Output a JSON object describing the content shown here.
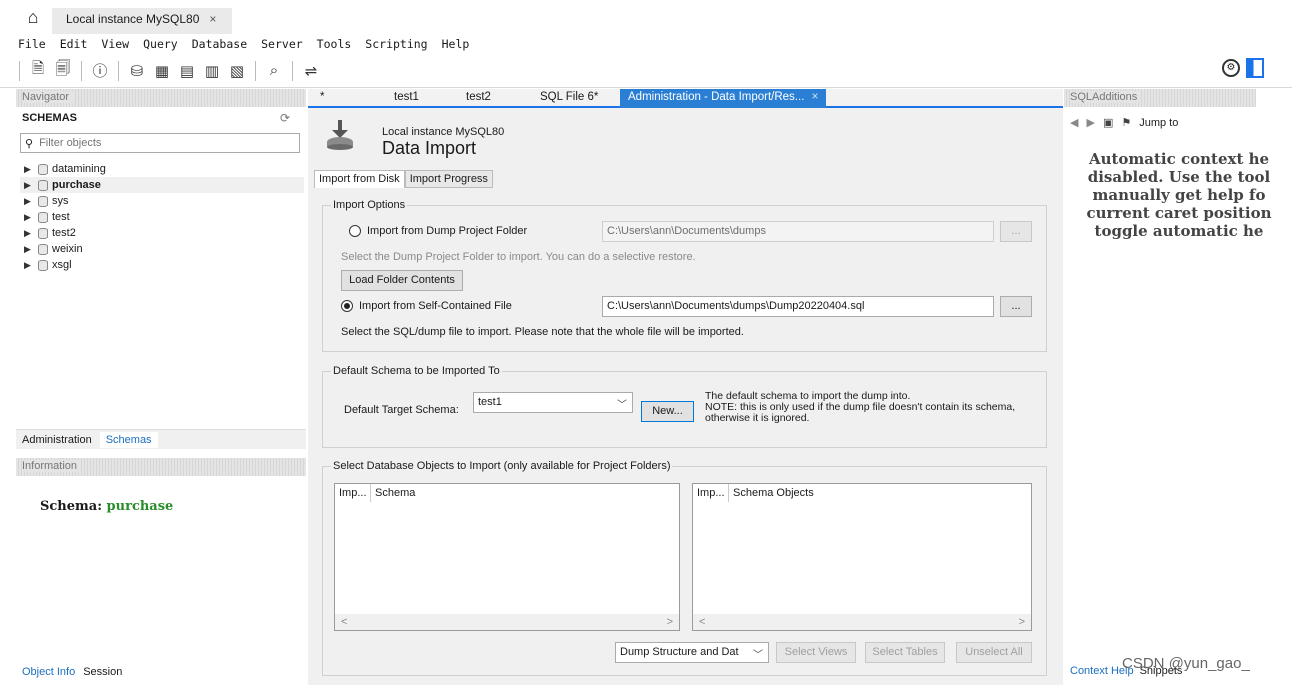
{
  "window": {
    "home_icon": "home-icon",
    "connection_tab": "Local instance MySQL80",
    "close_glyph": "×"
  },
  "menu": [
    "File",
    "Edit",
    "View",
    "Query",
    "Database",
    "Server",
    "Tools",
    "Scripting",
    "Help"
  ],
  "navigator": {
    "header": "Navigator",
    "schemas_label": "SCHEMAS",
    "filter_placeholder": "Filter objects",
    "schemas": [
      {
        "name": "datamining",
        "selected": false
      },
      {
        "name": "purchase",
        "selected": true
      },
      {
        "name": "sys",
        "selected": false
      },
      {
        "name": "test",
        "selected": false
      },
      {
        "name": "test2",
        "selected": false
      },
      {
        "name": "weixin",
        "selected": false
      },
      {
        "name": "xsgl",
        "selected": false
      }
    ],
    "tabs": [
      "Administration",
      "Schemas"
    ]
  },
  "information": {
    "header": "Information",
    "schema_label": "Schema:",
    "schema_value": "purchase",
    "tabs": [
      "Object Info",
      "Session"
    ]
  },
  "editor_tabs": {
    "dirty_marker": "*",
    "items": [
      "test1",
      "test2",
      "SQL File 6*",
      "Administration - Data Import/Res..."
    ],
    "close_glyph": "×"
  },
  "panel": {
    "instance": "Local instance MySQL80",
    "title": "Data Import",
    "subtabs": [
      "Import from Disk",
      "Import Progress"
    ],
    "import_options": {
      "title": "Import Options",
      "option1_label": "Import from Dump Project Folder",
      "option1_path": "C:\\Users\\ann\\Documents\\dumps",
      "option1_hint": "Select the Dump Project Folder to import. You can do a selective restore.",
      "load_button": "Load Folder Contents",
      "option2_label": "Import from Self-Contained File",
      "option2_path": "C:\\Users\\ann\\Documents\\dumps\\Dump20220404.sql",
      "option2_hint": "Select the SQL/dump file to import. Please note that the whole file will be imported.",
      "browse": "...",
      "selected_option": 2
    },
    "default_schema": {
      "title": "Default Schema to be Imported To",
      "label": "Default Target Schema:",
      "value": "test1",
      "new_button": "New...",
      "note1": "The default schema to import the dump into.",
      "note2": "NOTE: this is only used if the dump file doesn't contain its schema,",
      "note3": "otherwise it is ignored."
    },
    "db_objects": {
      "title": "Select Database Objects to Import (only available for Project Folders)",
      "left_cols": [
        "Imp...",
        "Schema"
      ],
      "right_cols": [
        "Imp...",
        "Schema Objects"
      ],
      "dump_select": "Dump Structure and Dat",
      "select_views": "Select Views",
      "select_tables": "Select Tables",
      "unselect_all": "Unselect All"
    }
  },
  "sql_additions": {
    "header": "SQLAdditions",
    "jump_to": "Jump to",
    "help_lines": [
      "Automatic context he",
      "disabled. Use the tool",
      "manually get help fo",
      "current caret position",
      "toggle automatic he"
    ],
    "tabs": [
      "Context Help",
      "Snippets"
    ]
  },
  "watermark": "CSDN @yun_gao_",
  "colors": {
    "accent": "#2a7fd4",
    "schema_value": "#2a8c2a"
  }
}
